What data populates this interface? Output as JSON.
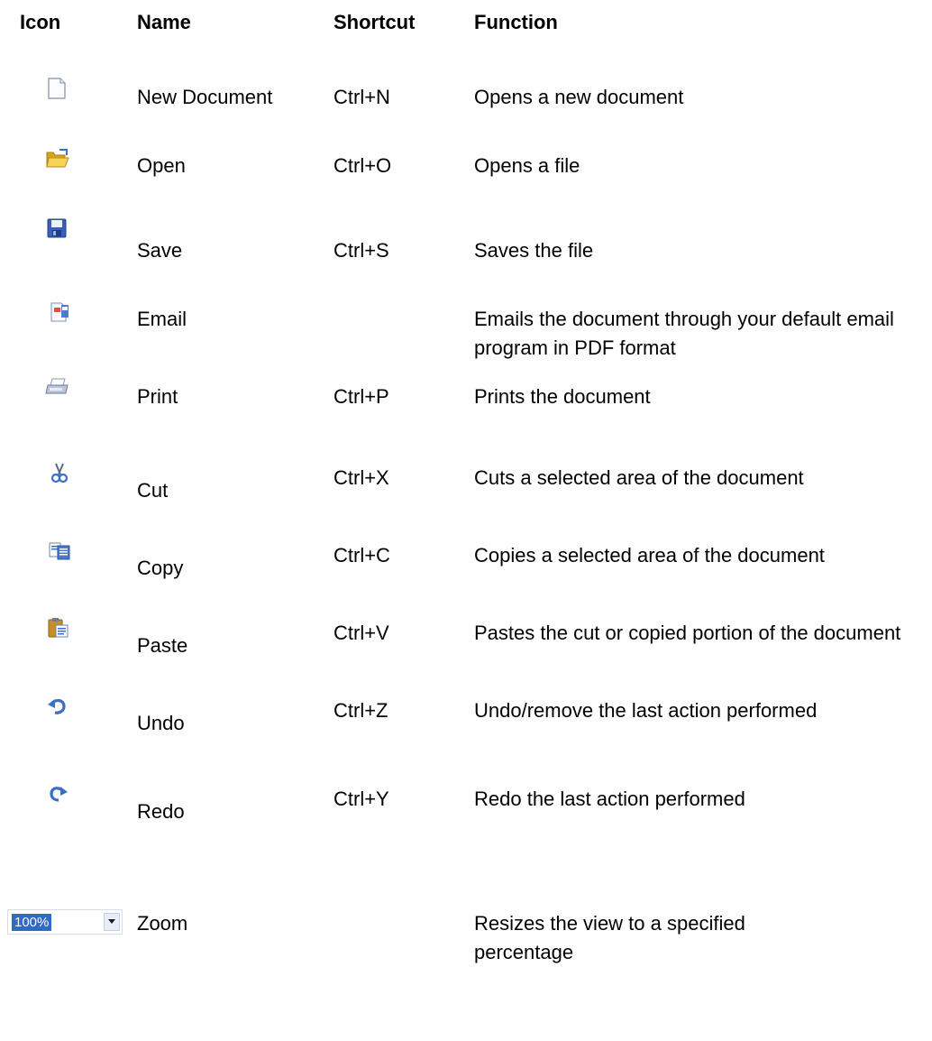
{
  "headers": {
    "icon": "Icon",
    "name": "Name",
    "shortcut": "Shortcut",
    "function": "Function"
  },
  "rows": [
    {
      "icon": "new-document-icon",
      "name": "New Document",
      "shortcut": "Ctrl+N",
      "function": "Opens a new document"
    },
    {
      "icon": "open-folder-icon",
      "name": "Open",
      "shortcut": "Ctrl+O",
      "function": "Opens a file"
    },
    {
      "icon": "save-disk-icon",
      "name": "Save",
      "shortcut": "Ctrl+S",
      "function": "Saves the file"
    },
    {
      "icon": "email-icon",
      "name": "Email",
      "shortcut": "",
      "function": "Emails the document through your default email program in PDF format"
    },
    {
      "icon": "printer-icon",
      "name": "Print",
      "shortcut": "Ctrl+P",
      "function": "Prints the document"
    },
    {
      "icon": "scissors-icon",
      "name": "Cut",
      "shortcut": "Ctrl+X",
      "function": "Cuts a selected area of the document"
    },
    {
      "icon": "copy-icon",
      "name": "Copy",
      "shortcut": "Ctrl+C",
      "function": "Copies a selected area of the document"
    },
    {
      "icon": "paste-clipboard-icon",
      "name": "Paste",
      "shortcut": "Ctrl+V",
      "function": "Pastes the cut or copied portion of the document"
    },
    {
      "icon": "undo-arrow-icon",
      "name": "Undo",
      "shortcut": "Ctrl+Z",
      "function": "Undo/remove the last action performed"
    },
    {
      "icon": "redo-arrow-icon",
      "name": "Redo",
      "shortcut": "Ctrl+Y",
      "function": "Redo the last action performed"
    },
    {
      "icon": "zoom-dropdown",
      "name": "Zoom",
      "shortcut": "",
      "function": "Resizes the view to a specified percentage"
    }
  ],
  "zoom_control": {
    "value": "100%"
  },
  "colors": {
    "icon_blue": "#3b6fc4",
    "folder_yellow": "#f2c94c",
    "selection_blue": "#3169c6"
  }
}
